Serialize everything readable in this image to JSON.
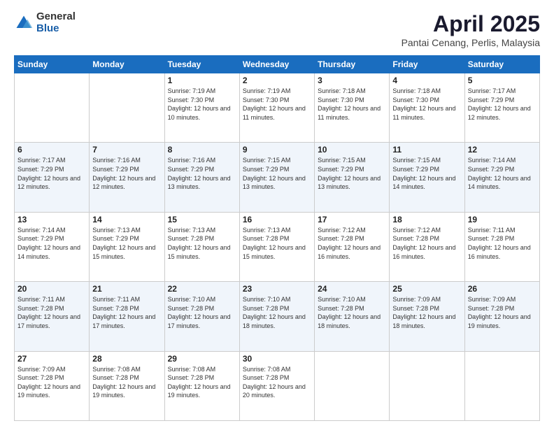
{
  "logo": {
    "general": "General",
    "blue": "Blue"
  },
  "header": {
    "title": "April 2025",
    "subtitle": "Pantai Cenang, Perlis, Malaysia"
  },
  "weekdays": [
    "Sunday",
    "Monday",
    "Tuesday",
    "Wednesday",
    "Thursday",
    "Friday",
    "Saturday"
  ],
  "weeks": [
    [
      {
        "day": "",
        "sunrise": "",
        "sunset": "",
        "daylight": ""
      },
      {
        "day": "",
        "sunrise": "",
        "sunset": "",
        "daylight": ""
      },
      {
        "day": "1",
        "sunrise": "Sunrise: 7:19 AM",
        "sunset": "Sunset: 7:30 PM",
        "daylight": "Daylight: 12 hours and 10 minutes."
      },
      {
        "day": "2",
        "sunrise": "Sunrise: 7:19 AM",
        "sunset": "Sunset: 7:30 PM",
        "daylight": "Daylight: 12 hours and 11 minutes."
      },
      {
        "day": "3",
        "sunrise": "Sunrise: 7:18 AM",
        "sunset": "Sunset: 7:30 PM",
        "daylight": "Daylight: 12 hours and 11 minutes."
      },
      {
        "day": "4",
        "sunrise": "Sunrise: 7:18 AM",
        "sunset": "Sunset: 7:30 PM",
        "daylight": "Daylight: 12 hours and 11 minutes."
      },
      {
        "day": "5",
        "sunrise": "Sunrise: 7:17 AM",
        "sunset": "Sunset: 7:29 PM",
        "daylight": "Daylight: 12 hours and 12 minutes."
      }
    ],
    [
      {
        "day": "6",
        "sunrise": "Sunrise: 7:17 AM",
        "sunset": "Sunset: 7:29 PM",
        "daylight": "Daylight: 12 hours and 12 minutes."
      },
      {
        "day": "7",
        "sunrise": "Sunrise: 7:16 AM",
        "sunset": "Sunset: 7:29 PM",
        "daylight": "Daylight: 12 hours and 12 minutes."
      },
      {
        "day": "8",
        "sunrise": "Sunrise: 7:16 AM",
        "sunset": "Sunset: 7:29 PM",
        "daylight": "Daylight: 12 hours and 13 minutes."
      },
      {
        "day": "9",
        "sunrise": "Sunrise: 7:15 AM",
        "sunset": "Sunset: 7:29 PM",
        "daylight": "Daylight: 12 hours and 13 minutes."
      },
      {
        "day": "10",
        "sunrise": "Sunrise: 7:15 AM",
        "sunset": "Sunset: 7:29 PM",
        "daylight": "Daylight: 12 hours and 13 minutes."
      },
      {
        "day": "11",
        "sunrise": "Sunrise: 7:15 AM",
        "sunset": "Sunset: 7:29 PM",
        "daylight": "Daylight: 12 hours and 14 minutes."
      },
      {
        "day": "12",
        "sunrise": "Sunrise: 7:14 AM",
        "sunset": "Sunset: 7:29 PM",
        "daylight": "Daylight: 12 hours and 14 minutes."
      }
    ],
    [
      {
        "day": "13",
        "sunrise": "Sunrise: 7:14 AM",
        "sunset": "Sunset: 7:29 PM",
        "daylight": "Daylight: 12 hours and 14 minutes."
      },
      {
        "day": "14",
        "sunrise": "Sunrise: 7:13 AM",
        "sunset": "Sunset: 7:29 PM",
        "daylight": "Daylight: 12 hours and 15 minutes."
      },
      {
        "day": "15",
        "sunrise": "Sunrise: 7:13 AM",
        "sunset": "Sunset: 7:28 PM",
        "daylight": "Daylight: 12 hours and 15 minutes."
      },
      {
        "day": "16",
        "sunrise": "Sunrise: 7:13 AM",
        "sunset": "Sunset: 7:28 PM",
        "daylight": "Daylight: 12 hours and 15 minutes."
      },
      {
        "day": "17",
        "sunrise": "Sunrise: 7:12 AM",
        "sunset": "Sunset: 7:28 PM",
        "daylight": "Daylight: 12 hours and 16 minutes."
      },
      {
        "day": "18",
        "sunrise": "Sunrise: 7:12 AM",
        "sunset": "Sunset: 7:28 PM",
        "daylight": "Daylight: 12 hours and 16 minutes."
      },
      {
        "day": "19",
        "sunrise": "Sunrise: 7:11 AM",
        "sunset": "Sunset: 7:28 PM",
        "daylight": "Daylight: 12 hours and 16 minutes."
      }
    ],
    [
      {
        "day": "20",
        "sunrise": "Sunrise: 7:11 AM",
        "sunset": "Sunset: 7:28 PM",
        "daylight": "Daylight: 12 hours and 17 minutes."
      },
      {
        "day": "21",
        "sunrise": "Sunrise: 7:11 AM",
        "sunset": "Sunset: 7:28 PM",
        "daylight": "Daylight: 12 hours and 17 minutes."
      },
      {
        "day": "22",
        "sunrise": "Sunrise: 7:10 AM",
        "sunset": "Sunset: 7:28 PM",
        "daylight": "Daylight: 12 hours and 17 minutes."
      },
      {
        "day": "23",
        "sunrise": "Sunrise: 7:10 AM",
        "sunset": "Sunset: 7:28 PM",
        "daylight": "Daylight: 12 hours and 18 minutes."
      },
      {
        "day": "24",
        "sunrise": "Sunrise: 7:10 AM",
        "sunset": "Sunset: 7:28 PM",
        "daylight": "Daylight: 12 hours and 18 minutes."
      },
      {
        "day": "25",
        "sunrise": "Sunrise: 7:09 AM",
        "sunset": "Sunset: 7:28 PM",
        "daylight": "Daylight: 12 hours and 18 minutes."
      },
      {
        "day": "26",
        "sunrise": "Sunrise: 7:09 AM",
        "sunset": "Sunset: 7:28 PM",
        "daylight": "Daylight: 12 hours and 19 minutes."
      }
    ],
    [
      {
        "day": "27",
        "sunrise": "Sunrise: 7:09 AM",
        "sunset": "Sunset: 7:28 PM",
        "daylight": "Daylight: 12 hours and 19 minutes."
      },
      {
        "day": "28",
        "sunrise": "Sunrise: 7:08 AM",
        "sunset": "Sunset: 7:28 PM",
        "daylight": "Daylight: 12 hours and 19 minutes."
      },
      {
        "day": "29",
        "sunrise": "Sunrise: 7:08 AM",
        "sunset": "Sunset: 7:28 PM",
        "daylight": "Daylight: 12 hours and 19 minutes."
      },
      {
        "day": "30",
        "sunrise": "Sunrise: 7:08 AM",
        "sunset": "Sunset: 7:28 PM",
        "daylight": "Daylight: 12 hours and 20 minutes."
      },
      {
        "day": "",
        "sunrise": "",
        "sunset": "",
        "daylight": ""
      },
      {
        "day": "",
        "sunrise": "",
        "sunset": "",
        "daylight": ""
      },
      {
        "day": "",
        "sunrise": "",
        "sunset": "",
        "daylight": ""
      }
    ]
  ]
}
